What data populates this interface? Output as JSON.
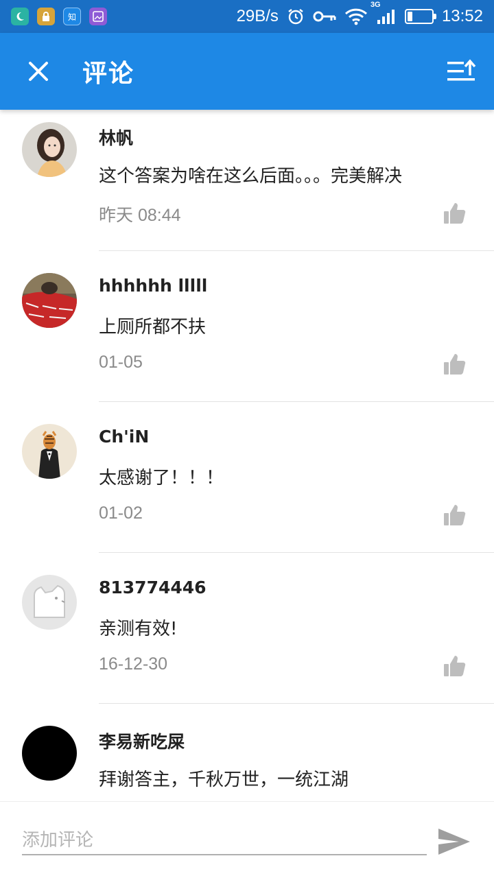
{
  "status_bar": {
    "app_icons": [
      "moon-icon",
      "lock-app-icon",
      "zhihu-app-icon",
      "gallery-app-icon"
    ],
    "zhihu_glyph": "知",
    "net_speed": "29B/s",
    "network_type": "3G",
    "time": "13:52",
    "battery_level": 0.2
  },
  "app_bar": {
    "title": "评论",
    "background": "#1e88e5"
  },
  "comments": [
    {
      "name": "林帆",
      "text": "这个答案为啥在这么后面。。。完美解决",
      "time": "昨天 08:44"
    },
    {
      "name": "hhhhhh lllll",
      "text": "上厕所都不扶",
      "time": "01-05"
    },
    {
      "name": "Ch'iN",
      "text": "太感谢了！！！",
      "time": "01-02"
    },
    {
      "name": "813774446",
      "text": "亲测有效!",
      "time": "16-12-30"
    },
    {
      "name": "李易新吃屎",
      "text": "拜谢答主，千秋万世，一统江湖",
      "time": ""
    }
  ],
  "input": {
    "placeholder": "添加评论",
    "value": ""
  },
  "colors": {
    "status_bar": "#1a6fc4",
    "accent": "#1e88e5",
    "timestamp": "#8a8a8a",
    "divider": "#e3e3e3"
  }
}
